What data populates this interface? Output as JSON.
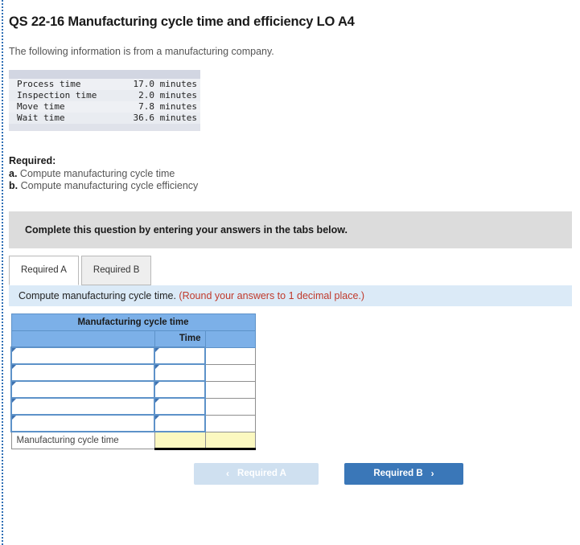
{
  "question": {
    "title": "QS 22-16 Manufacturing cycle time and efficiency LO A4",
    "intro": "The following information is from a manufacturing company."
  },
  "given_data": {
    "rows": [
      {
        "label": "Process time",
        "value": "17.0 minutes"
      },
      {
        "label": "Inspection time",
        "value": "2.0 minutes"
      },
      {
        "label": "Move time",
        "value": "7.8 minutes"
      },
      {
        "label": "Wait time",
        "value": "36.6 minutes"
      }
    ]
  },
  "required": {
    "heading": "Required:",
    "items": [
      {
        "marker": "a.",
        "text": "Compute manufacturing cycle time"
      },
      {
        "marker": "b.",
        "text": "Compute manufacturing cycle efficiency"
      }
    ]
  },
  "banner": {
    "text": "Complete this question by entering your answers in the tabs below."
  },
  "tabs": [
    {
      "label": "Required A",
      "active": true
    },
    {
      "label": "Required B",
      "active": false
    }
  ],
  "instruction": {
    "text": "Compute manufacturing cycle time.",
    "round_note": "(Round your answers to 1 decimal place.)"
  },
  "answer_table": {
    "title": "Manufacturing cycle time",
    "column_headers": [
      "",
      "Time",
      ""
    ],
    "input_rows": [
      {
        "label": "",
        "time": "",
        "extra": ""
      },
      {
        "label": "",
        "time": "",
        "extra": ""
      },
      {
        "label": "",
        "time": "",
        "extra": ""
      },
      {
        "label": "",
        "time": "",
        "extra": ""
      },
      {
        "label": "",
        "time": "",
        "extra": ""
      }
    ],
    "total_row": {
      "label": "Manufacturing cycle time",
      "time": "",
      "extra": ""
    }
  },
  "nav": {
    "prev_label": "Required A",
    "prev_icon": "chevron-left",
    "next_label": "Required B",
    "next_icon": "chevron-right",
    "prev_chevron": "‹",
    "next_chevron": "›"
  },
  "colors": {
    "header_blue": "#7cb0e8",
    "button_blue": "#3a77b8",
    "button_disabled": "#cfe0f0",
    "strip_blue": "#dbeaf7",
    "banner_gray": "#dcdcdc",
    "yellow_cell": "#fbf8c0",
    "round_note_red": "#c0392b"
  }
}
